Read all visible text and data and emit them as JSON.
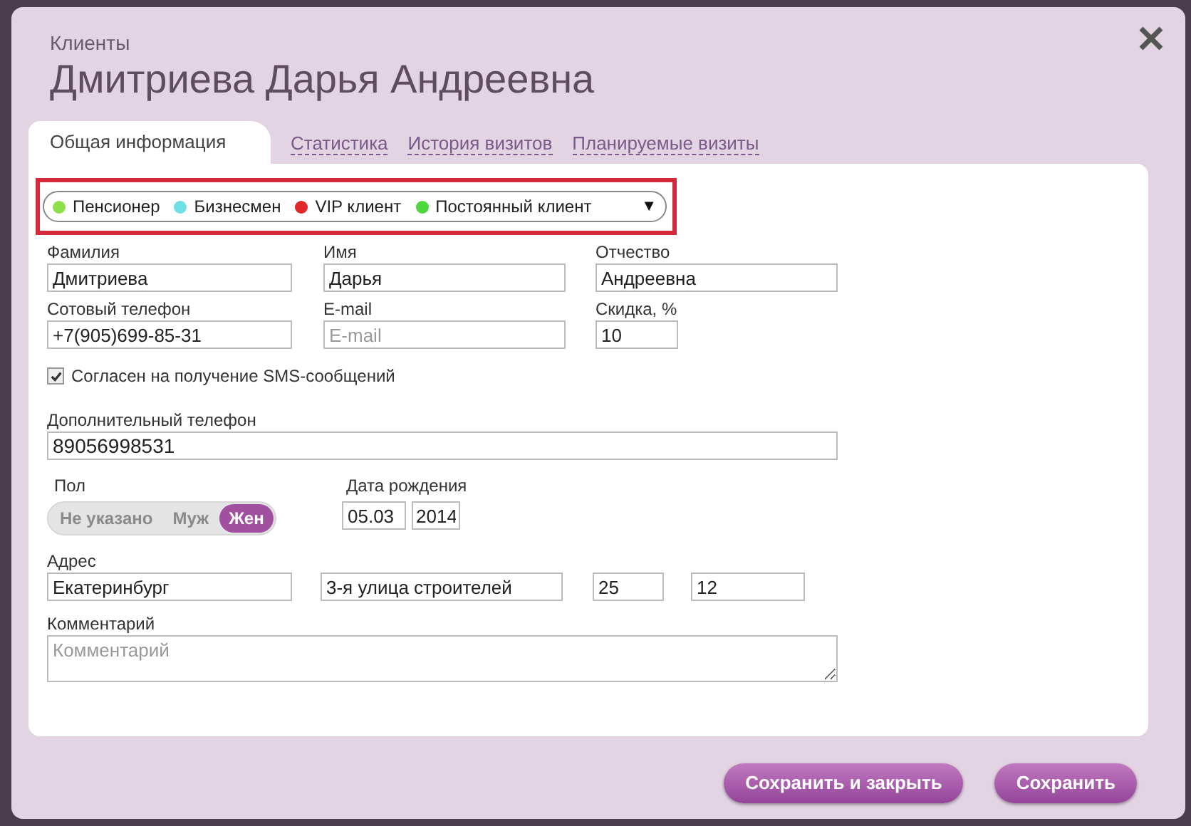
{
  "header": {
    "breadcrumb": "Клиенты",
    "title": "Дмитриева Дарья Андреевна"
  },
  "tabs": [
    {
      "label": "Общая информация",
      "selected": true
    },
    {
      "label": "Статистика",
      "selected": false
    },
    {
      "label": "История визитов",
      "selected": false
    },
    {
      "label": "Планируемые визиты",
      "selected": false
    }
  ],
  "tags": {
    "items": [
      {
        "label": "Пенсионер",
        "color": "#8ee04a"
      },
      {
        "label": "Бизнесмен",
        "color": "#6fe0e4"
      },
      {
        "label": "VIP клиент",
        "color": "#e02828"
      },
      {
        "label": "Постоянный клиент",
        "color": "#4ed63e"
      }
    ],
    "dropdown": "▼"
  },
  "name_fields": [
    {
      "label": "Фамилия",
      "value": "Дмитриева"
    },
    {
      "label": "Имя",
      "value": "Дарья"
    },
    {
      "label": "Отчество",
      "value": "Андреевна"
    }
  ],
  "contact_fields": [
    {
      "label": "Сотовый телефон",
      "value": "+7(905)699-85-31"
    },
    {
      "label": "E-mail",
      "placeholder": "E-mail"
    },
    {
      "label": "Скидка, %",
      "value": "10"
    }
  ],
  "sms_consent": {
    "label": "Согласен на получение SMS-сообщений",
    "checked": true
  },
  "extra_phone": {
    "label": "Дополнительный телефон",
    "value": "89056998531"
  },
  "gender": {
    "label": "Пол",
    "options": [
      {
        "label": "Не указано",
        "selected": false
      },
      {
        "label": "Муж",
        "selected": false
      },
      {
        "label": "Жен",
        "selected": true
      }
    ]
  },
  "birth_date": {
    "label": "Дата рождения",
    "day_month": "05.03",
    "year": "2014"
  },
  "address": {
    "label": "Адрес",
    "fields": [
      {
        "value": "Екатеринбург"
      },
      {
        "value": "3-я улица строителей"
      },
      {
        "value": "25"
      },
      {
        "value": "12"
      }
    ]
  },
  "comment": {
    "label": "Комментарий",
    "placeholder": "Комментарий"
  },
  "buttons": [
    {
      "label": "Сохранить и закрыть"
    },
    {
      "label": "Сохранить"
    }
  ]
}
